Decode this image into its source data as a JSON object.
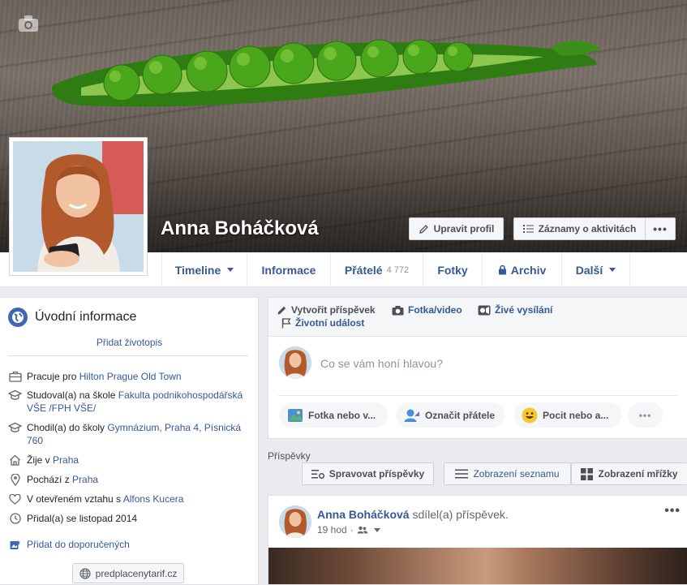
{
  "profile": {
    "name": "Anna Boháčková",
    "edit_label": "Upravit profil",
    "activity_label": "Záznamy o aktivitách",
    "more_label": "•••"
  },
  "tabs": [
    {
      "label": "Timeline",
      "dropdown": true
    },
    {
      "label": "Informace"
    },
    {
      "label": "Přátelé",
      "count": "4 772"
    },
    {
      "label": "Fotky"
    },
    {
      "label": "Archiv",
      "locked": true
    },
    {
      "label": "Další",
      "dropdown": true
    }
  ],
  "intro": {
    "title": "Úvodní informace",
    "add_bio": "Přidat životopis",
    "work_prefix": "Pracuje pro ",
    "work_link": "Hilton Prague Old Town",
    "study_prefix": "Studoval(a) na škole ",
    "study_link": "Fakulta podnikohospodářská VŠE /FPH VŠE/",
    "school_prefix": "Chodil(a) do školy ",
    "school_link": "Gymnázium, Praha 4, Písnická 760",
    "lives_prefix": "Žije v ",
    "lives_link": "Praha",
    "from_prefix": "Pochází z ",
    "from_link": "Praha",
    "rel_prefix": "V otevřeném vztahu s ",
    "rel_link": "Alfons Kucera",
    "joined": "Přidal(a) se listopad 2014",
    "featured": "Přidat do doporučených",
    "website": "predplacenytarif.cz"
  },
  "composer": {
    "create_post": "Vytvořit příspěvek",
    "photo_video": "Fotka/video",
    "live": "Živé vysílání",
    "life_event": "Životní událost",
    "placeholder": "Co se vám honí hlavou?",
    "photo_pill": "Fotka nebo v...",
    "tag_pill": "Označit přátele",
    "feeling_pill": "Pocit nebo a...",
    "more_pill": "•••"
  },
  "posts": {
    "title": "Příspěvky",
    "manage": "Spravovat příspěvky",
    "list_view": "Zobrazení seznamu",
    "grid_view": "Zobrazení mřížky"
  },
  "post": {
    "author": "Anna Boháčková",
    "action": " sdílel(a) příspěvek.",
    "time": "19 hod",
    "dots": "•••"
  },
  "colors": {
    "link": "#365899",
    "page_bg": "#e9ebee",
    "brand": "#4267b2"
  }
}
